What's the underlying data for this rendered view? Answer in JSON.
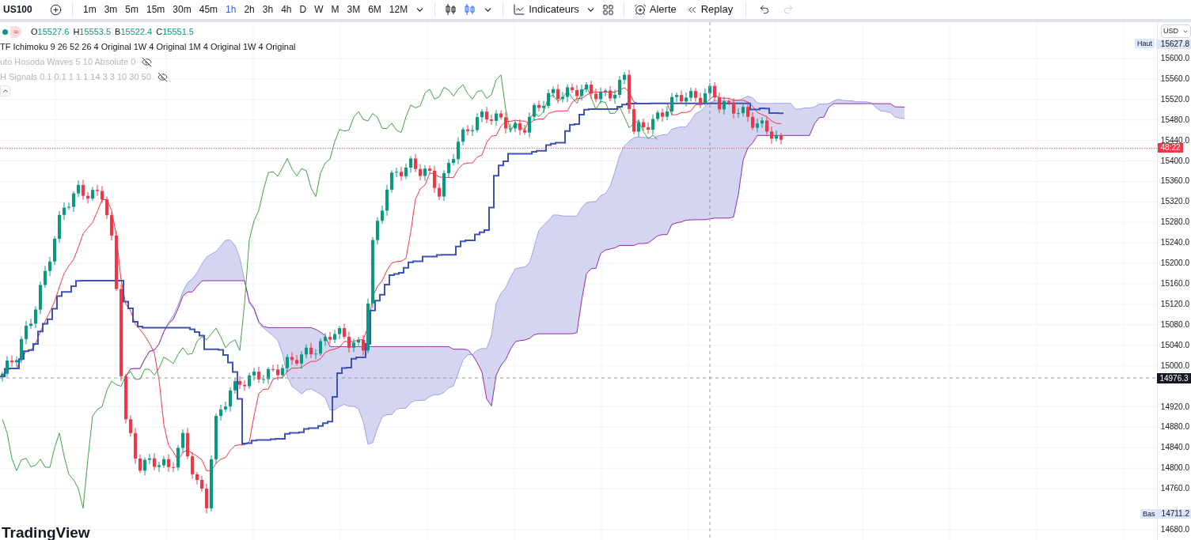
{
  "toolbar": {
    "symbol": "US100",
    "timeframes": [
      {
        "label": "1m",
        "selected": false
      },
      {
        "label": "3m",
        "selected": false
      },
      {
        "label": "5m",
        "selected": false
      },
      {
        "label": "15m",
        "selected": false
      },
      {
        "label": "30m",
        "selected": false
      },
      {
        "label": "45m",
        "selected": false
      },
      {
        "label": "1h",
        "selected": true
      },
      {
        "label": "2h",
        "selected": false
      },
      {
        "label": "3h",
        "selected": false
      },
      {
        "label": "4h",
        "selected": false
      },
      {
        "label": "D",
        "selected": false
      },
      {
        "label": "W",
        "selected": false
      },
      {
        "label": "M",
        "selected": false
      },
      {
        "label": "3M",
        "selected": false
      },
      {
        "label": "6M",
        "selected": false
      },
      {
        "label": "12M",
        "selected": false
      }
    ],
    "indicators_button": "Indicateurs",
    "alert_button": "Alerte",
    "replay_button": "Replay"
  },
  "legend": {
    "badge_symbol": "≈",
    "ohlc": [
      {
        "key": "O",
        "value": "15527.6"
      },
      {
        "key": "H",
        "value": "15553.5"
      },
      {
        "key": "B",
        "value": "15522.4"
      },
      {
        "key": "C",
        "value": "15551.5"
      }
    ],
    "indicators": [
      {
        "label": "TF Ichimoku 9 26 52 26 4 Original 1W 4 Original 1M 4 Original 1W 4 Original",
        "hidden": false
      },
      {
        "label": "uto Hosoda Waves 5 10 Absolute 0",
        "hidden": true
      },
      {
        "label": "H Signals 0.1 0.1 1 1 1 14 3 3 10 30 50",
        "hidden": true
      }
    ]
  },
  "price_axis": {
    "currency": "USD",
    "high": {
      "label": "Haut",
      "value": "15627.8"
    },
    "low": {
      "label": "Bas",
      "value": "14711.2"
    },
    "countdown": "48:22",
    "crosshair_price": "14976.3",
    "ticks": [
      "15600.0",
      "15560.0",
      "15520.0",
      "15480.0",
      "15440.0",
      "15400.0",
      "15360.0",
      "15320.0",
      "15280.0",
      "15240.0",
      "15200.0",
      "15160.0",
      "15120.0",
      "15080.0",
      "15040.0",
      "15000.0",
      "14920.0",
      "14880.0",
      "14840.0",
      "14800.0",
      "14760.0",
      "14680.0"
    ]
  },
  "branding": "TradingView"
}
